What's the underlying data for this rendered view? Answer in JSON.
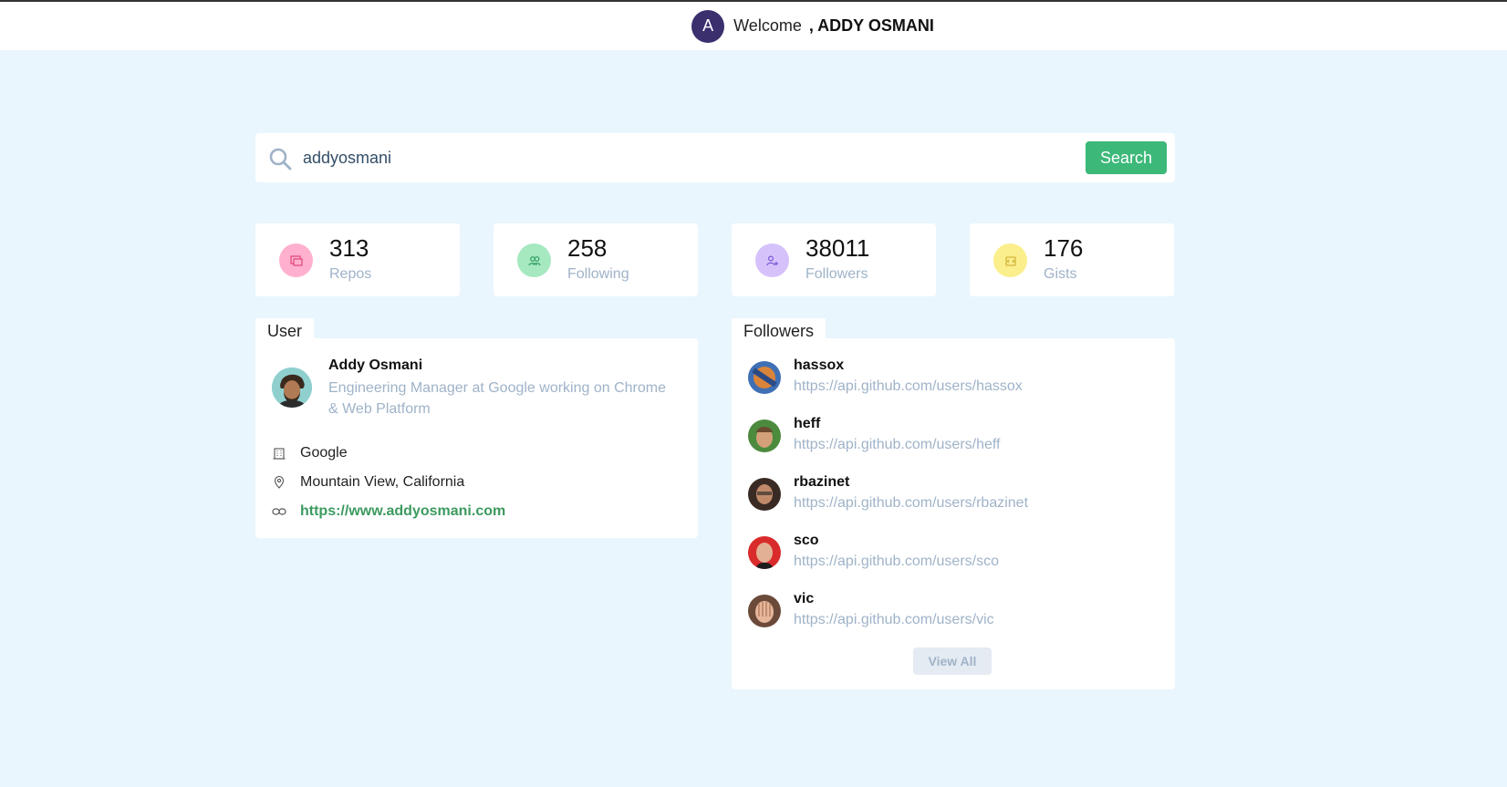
{
  "header": {
    "avatar_letter": "A",
    "welcome": "Welcome",
    "user_name": ", ADDY OSMANI"
  },
  "search": {
    "value": "addyosmani",
    "button_label": "Search"
  },
  "stats": [
    {
      "value": "313",
      "label": "Repos",
      "color": "#ffb0cf",
      "icon": "repo-icon"
    },
    {
      "value": "258",
      "label": "Following",
      "color": "#a6e8c0",
      "icon": "users-icon"
    },
    {
      "value": "38011",
      "label": "Followers",
      "color": "#d6c2fb",
      "icon": "user-plus-icon"
    },
    {
      "value": "176",
      "label": "Gists",
      "color": "#fbee8c",
      "icon": "code-icon"
    }
  ],
  "user": {
    "tab_label": "User",
    "name": "Addy Osmani",
    "bio": "Engineering Manager at Google working on Chrome & Web Platform",
    "company": "Google",
    "location": "Mountain View, California",
    "blog": "https://www.addyosmani.com"
  },
  "followers": {
    "tab_label": "Followers",
    "items": [
      {
        "name": "hassox",
        "url": "https://api.github.com/users/hassox"
      },
      {
        "name": "heff",
        "url": "https://api.github.com/users/heff"
      },
      {
        "name": "rbazinet",
        "url": "https://api.github.com/users/rbazinet"
      },
      {
        "name": "sco",
        "url": "https://api.github.com/users/sco"
      },
      {
        "name": "vic",
        "url": "https://api.github.com/users/vic"
      }
    ],
    "view_all_label": "View All"
  },
  "colors": {
    "background": "#eaf6fd",
    "accent": "#3cb879",
    "link": "#3c9a5f",
    "muted": "#9fb3c8"
  }
}
